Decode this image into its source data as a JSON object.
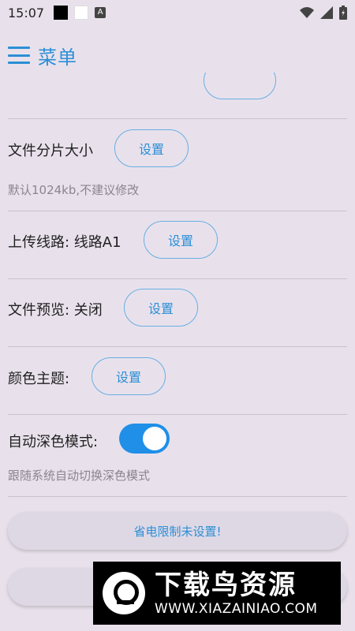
{
  "status_bar": {
    "time": "15:07",
    "icons": [
      "black-square-icon",
      "white-square-icon",
      "a-badge-icon",
      "wifi-icon",
      "signal-icon",
      "battery-icon"
    ],
    "a_badge": "A"
  },
  "app_bar": {
    "title": "菜单",
    "accent_color": "#2b8fd6"
  },
  "settings": {
    "file_chunk": {
      "label": "文件分片大小",
      "button": "设置",
      "hint": "默认1024kb,不建议修改"
    },
    "upload_route": {
      "label": "上传线路: 线路A1",
      "button": "设置"
    },
    "file_preview": {
      "label": "文件预览: 关闭",
      "button": "设置"
    },
    "color_theme": {
      "label": "颜色主题:",
      "button": "设置"
    },
    "auto_dark": {
      "label": "自动深色模式:",
      "enabled": true,
      "hint": "跟随系统自动切换深色模式"
    }
  },
  "power_limit_button": "省电限制未设置!",
  "watermark": {
    "title": "下载鸟资源",
    "url": "WWW.XIAZAINIAO.COM"
  }
}
